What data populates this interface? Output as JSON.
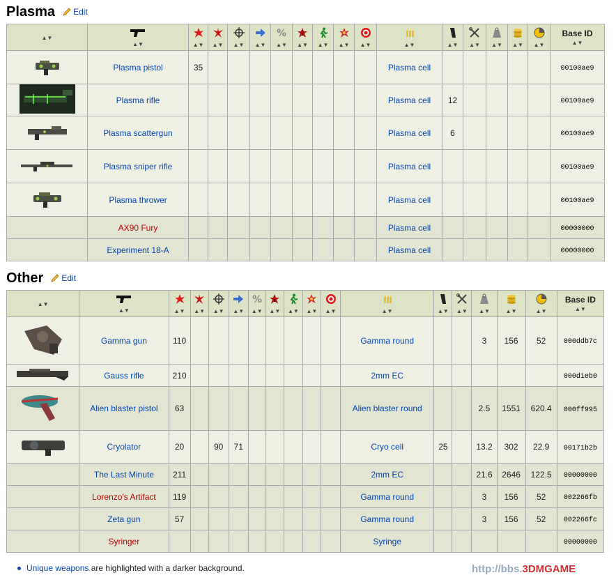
{
  "sections": [
    {
      "title": "Plasma",
      "edit_label": "Edit",
      "header": {
        "base_id": "Base ID"
      },
      "rows": [
        {
          "name": "Plasma pistol",
          "unique": false,
          "red": false,
          "c1": "35",
          "ammo": "Plasma cell",
          "cap": "",
          "weight": "",
          "value": "",
          "vw": "",
          "base_id": "00100ae9",
          "img": "plasma-pistol-image"
        },
        {
          "name": "Plasma rifle",
          "unique": false,
          "red": false,
          "c1": "",
          "ammo": "Plasma cell",
          "cap": "12",
          "weight": "",
          "value": "",
          "vw": "",
          "base_id": "00100ae9",
          "img": "plasma-rifle-image"
        },
        {
          "name": "Plasma scattergun",
          "unique": false,
          "red": false,
          "c1": "",
          "ammo": "Plasma cell",
          "cap": "6",
          "weight": "",
          "value": "",
          "vw": "",
          "base_id": "00100ae9",
          "img": "plasma-scattergun-image"
        },
        {
          "name": "Plasma sniper rifle",
          "unique": false,
          "red": false,
          "c1": "",
          "ammo": "Plasma cell",
          "cap": "",
          "weight": "",
          "value": "",
          "vw": "",
          "base_id": "00100ae9",
          "img": "plasma-sniper-rifle-image"
        },
        {
          "name": "Plasma thrower",
          "unique": false,
          "red": false,
          "c1": "",
          "ammo": "Plasma cell",
          "cap": "",
          "weight": "",
          "value": "",
          "vw": "",
          "base_id": "00100ae9",
          "img": "plasma-thrower-image"
        },
        {
          "name": "AX90 Fury",
          "unique": true,
          "red": true,
          "c1": "",
          "ammo": "Plasma cell",
          "cap": "",
          "weight": "",
          "value": "",
          "vw": "",
          "base_id": "00000000",
          "img": ""
        },
        {
          "name": "Experiment 18-A",
          "unique": true,
          "red": false,
          "c1": "",
          "ammo": "Plasma cell",
          "cap": "",
          "weight": "",
          "value": "",
          "vw": "",
          "base_id": "00000000",
          "img": ""
        }
      ]
    },
    {
      "title": "Other",
      "edit_label": "Edit",
      "header": {
        "base_id": "Base ID"
      },
      "rows": [
        {
          "name": "Gamma gun",
          "unique": false,
          "red": false,
          "c1": "110",
          "c4": "",
          "c5": "",
          "ammo": "Gamma round",
          "cap": "",
          "weight": "3",
          "value": "156",
          "vw": "52",
          "base_id": "000ddb7c",
          "img": "gamma-gun-image"
        },
        {
          "name": "Gauss rifle",
          "unique": false,
          "red": false,
          "c1": "210",
          "c4": "",
          "c5": "",
          "ammo": "2mm EC",
          "cap": "",
          "weight": "",
          "value": "",
          "vw": "",
          "base_id": "000d1eb0",
          "img": "gauss-rifle-image"
        },
        {
          "name": "Alien blaster pistol",
          "unique": true,
          "red": false,
          "c1": "63",
          "c4": "",
          "c5": "",
          "ammo": "Alien blaster round",
          "cap": "",
          "weight": "2.5",
          "value": "1551",
          "vw": "620.4",
          "base_id": "000ff995",
          "img": "alien-blaster-image"
        },
        {
          "name": "Cryolator",
          "unique": false,
          "red": false,
          "c1": "20",
          "c4": "90",
          "c5": "71",
          "ammo": "Cryo cell",
          "cap": "25",
          "weight": "13.2",
          "value": "302",
          "vw": "22.9",
          "base_id": "00171b2b",
          "img": "cryolator-image"
        },
        {
          "name": "The Last Minute",
          "unique": true,
          "red": false,
          "c1": "211",
          "c4": "",
          "c5": "",
          "ammo": "2mm EC",
          "cap": "",
          "weight": "21.6",
          "value": "2646",
          "vw": "122.5",
          "base_id": "00000000",
          "img": ""
        },
        {
          "name": "Lorenzo's Artifact",
          "unique": true,
          "red": true,
          "c1": "119",
          "c4": "",
          "c5": "",
          "ammo": "Gamma round",
          "cap": "",
          "weight": "3",
          "value": "156",
          "vw": "52",
          "base_id": "002266fb",
          "img": ""
        },
        {
          "name": "Zeta gun",
          "unique": true,
          "red": false,
          "c1": "57",
          "c4": "",
          "c5": "",
          "ammo": "Gamma round",
          "cap": "",
          "weight": "3",
          "value": "156",
          "vw": "52",
          "base_id": "002266fc",
          "img": ""
        },
        {
          "name": "Syringer",
          "unique": true,
          "red": true,
          "c1": "",
          "c4": "",
          "c5": "",
          "ammo": "Syringe",
          "cap": "",
          "weight": "",
          "value": "",
          "vw": "",
          "base_id": "00000000",
          "img": ""
        }
      ]
    }
  ],
  "footer": {
    "link": "Unique weapons",
    "text": " are highlighted with a darker background."
  },
  "watermark": {
    "prefix": "http://bbs.",
    "brand": "3DMGAME"
  },
  "icons": [
    "sort-icon",
    "pistol-icon",
    "damage-icon",
    "burst-icon",
    "crosshair-icon",
    "arrow-icon",
    "percent-icon",
    "bleed-icon",
    "runner-icon",
    "explosion-icon",
    "target-icon",
    "ammo-icon",
    "magazine-icon",
    "tools-icon",
    "weight-icon",
    "coins-icon",
    "pie-icon"
  ]
}
